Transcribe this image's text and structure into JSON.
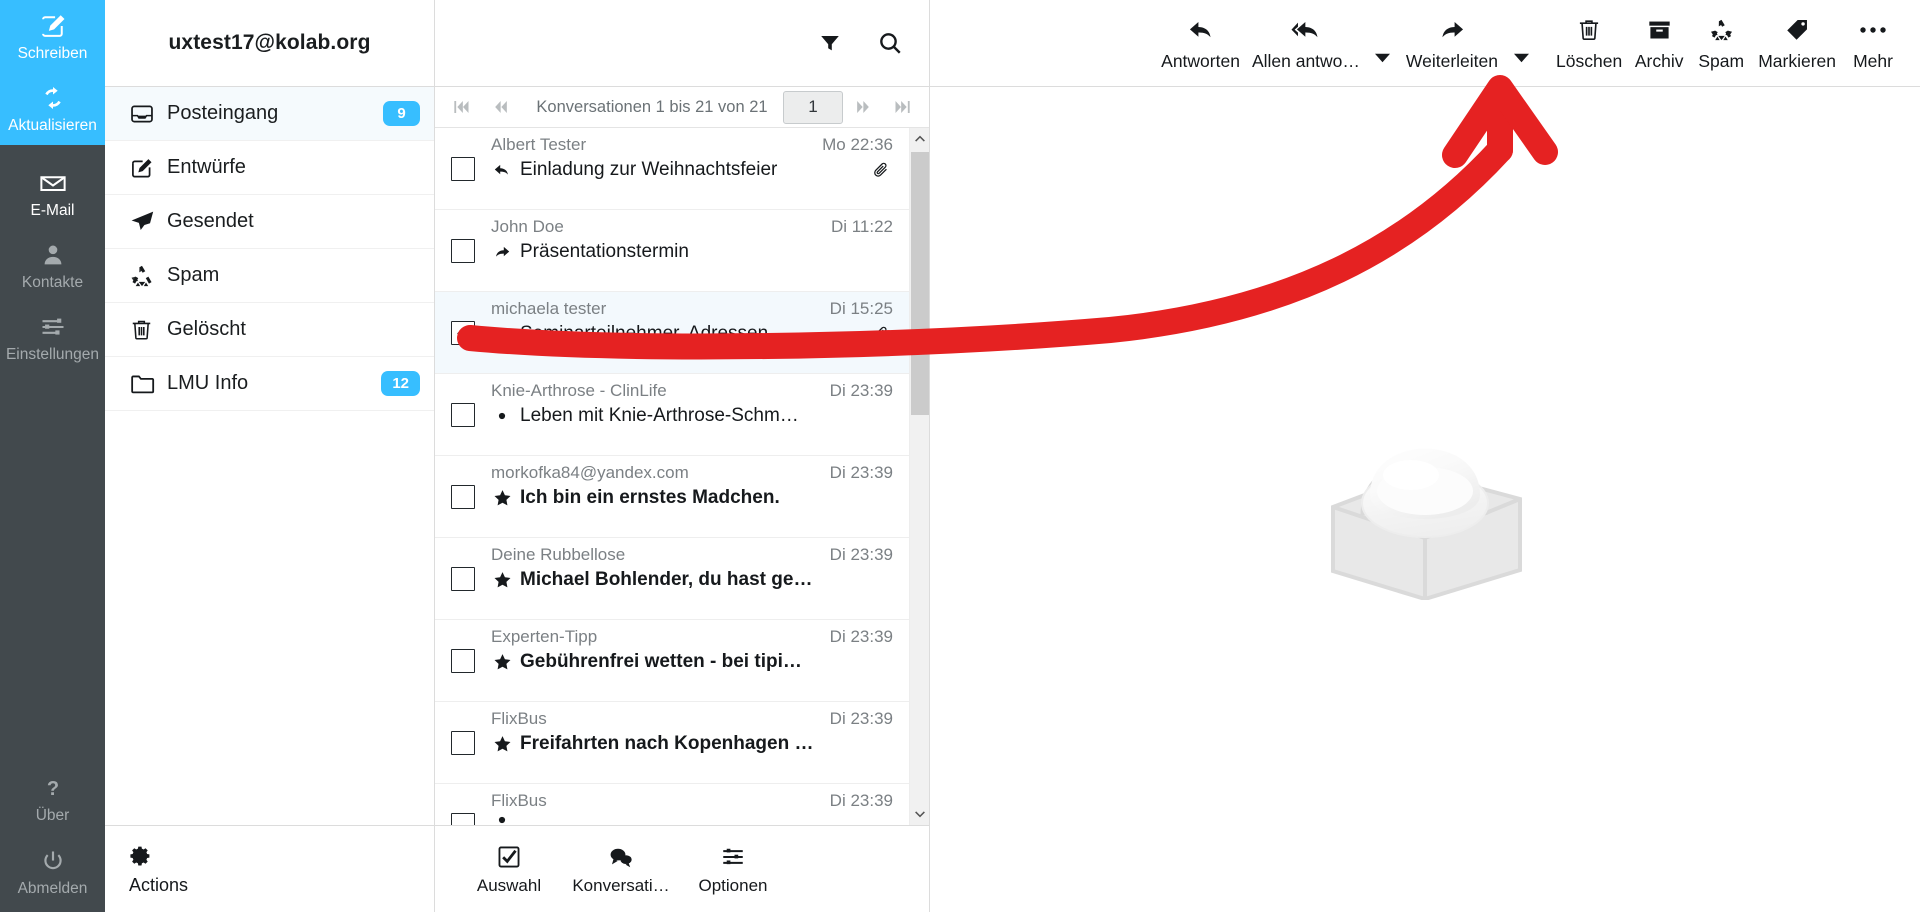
{
  "colors": {
    "accent": "#37beff",
    "rail_bg": "#42494d",
    "rail_text": "#a4aaad",
    "badge": "#37beff",
    "selected_row": "#f3f9fd",
    "annotation": "#e52222"
  },
  "taskmenu": {
    "items": [
      {
        "label": "Schreiben",
        "icon": "compose-icon",
        "state": "accent"
      },
      {
        "label": "Aktualisieren",
        "icon": "refresh-icon",
        "state": "accent"
      },
      {
        "label": "E-Mail",
        "icon": "envelope-icon",
        "state": "active"
      },
      {
        "label": "Kontakte",
        "icon": "person-icon",
        "state": "normal"
      },
      {
        "label": "Einstellungen",
        "icon": "sliders-icon",
        "state": "normal"
      }
    ],
    "bottom_items": [
      {
        "label": "Über",
        "icon": "question-icon"
      },
      {
        "label": "Abmelden",
        "icon": "power-icon"
      }
    ]
  },
  "folders": {
    "account": "uxtest17@kolab.org",
    "items": [
      {
        "label": "Posteingang",
        "icon": "inbox-icon",
        "badge": "9",
        "selected": true
      },
      {
        "label": "Entwürfe",
        "icon": "draft-icon",
        "badge": "",
        "selected": false
      },
      {
        "label": "Gesendet",
        "icon": "sent-icon",
        "badge": "",
        "selected": false
      },
      {
        "label": "Spam",
        "icon": "junk-icon",
        "badge": "",
        "selected": false
      },
      {
        "label": "Gelöscht",
        "icon": "trash-icon",
        "badge": "",
        "selected": false
      },
      {
        "label": "LMU Info",
        "icon": "folder-icon",
        "badge": "12",
        "selected": false
      }
    ],
    "footer": {
      "label": "Actions",
      "icon": "gear-icon"
    }
  },
  "messagelist": {
    "header_icons": [
      {
        "name": "filter-icon"
      },
      {
        "name": "search-icon"
      }
    ],
    "pagination": {
      "first": "first-page-icon",
      "prev": "prev-page-icon",
      "summary": "Konversationen 1 bis 21 von 21",
      "page_value": "1",
      "next": "next-page-icon",
      "last": "last-page-icon"
    },
    "rows": [
      {
        "from": "Albert Tester",
        "date": "Mo 22:36",
        "subject": "Einladung zur Weihnachtsfeier",
        "flag": "replied",
        "attachment": true,
        "unread": false,
        "checked": false,
        "selected": false
      },
      {
        "from": "John Doe",
        "date": "Di 11:22",
        "subject": "Präsentationstermin",
        "flag": "forwarded",
        "attachment": false,
        "unread": false,
        "checked": false,
        "selected": false
      },
      {
        "from": "michaela tester",
        "date": "Di 15:25",
        "subject": "Seminarteilnehmer, Adressen …",
        "flag": "unread-dot",
        "attachment": true,
        "unread": false,
        "checked": true,
        "selected": true
      },
      {
        "from": "Knie-Arthrose - ClinLife",
        "date": "Di 23:39",
        "subject": "Leben mit Knie-Arthrose-Schm…",
        "flag": "unread-dot",
        "attachment": false,
        "unread": false,
        "checked": false,
        "selected": false
      },
      {
        "from": "morkofka84@yandex.com",
        "date": "Di 23:39",
        "subject": "Ich bin ein ernstes Madchen.",
        "flag": "flagged",
        "attachment": false,
        "unread": true,
        "checked": false,
        "selected": false
      },
      {
        "from": "Deine Rubbellose",
        "date": "Di 23:39",
        "subject": "Michael Bohlender, du hast ge…",
        "flag": "flagged",
        "attachment": false,
        "unread": true,
        "checked": false,
        "selected": false
      },
      {
        "from": "Experten-Tipp",
        "date": "Di 23:39",
        "subject": "Gebührenfrei wetten - bei tipi…",
        "flag": "flagged",
        "attachment": false,
        "unread": true,
        "checked": false,
        "selected": false
      },
      {
        "from": "FlixBus",
        "date": "Di 23:39",
        "subject": "Freifahrten nach Kopenhagen …",
        "flag": "flagged",
        "attachment": false,
        "unread": true,
        "checked": false,
        "selected": false
      },
      {
        "from": "FlixBus",
        "date": "Di 23:39",
        "subject": "",
        "flag": "unread-dot",
        "attachment": false,
        "unread": true,
        "checked": false,
        "selected": false
      }
    ],
    "footer": [
      {
        "label": "Auswahl",
        "icon": "checkbox-icon"
      },
      {
        "label": "Konversati…",
        "icon": "conversation-icon"
      },
      {
        "label": "Optionen",
        "icon": "options-icon"
      }
    ]
  },
  "toolbar": {
    "buttons": [
      {
        "label": "Antworten",
        "icon": "reply-icon",
        "caret": false
      },
      {
        "label": "Allen antwo…",
        "icon": "reply-all-icon",
        "caret": true
      },
      {
        "label": "Weiterleiten",
        "icon": "forward-icon",
        "caret": true
      },
      {
        "label": "Löschen",
        "icon": "trash-icon",
        "caret": false
      },
      {
        "label": "Archiv",
        "icon": "archive-icon",
        "caret": false
      },
      {
        "label": "Spam",
        "icon": "junk-icon",
        "caret": false
      },
      {
        "label": "Markieren",
        "icon": "tag-icon",
        "caret": false
      },
      {
        "label": "Mehr",
        "icon": "ellipsis-icon",
        "caret": false
      }
    ]
  },
  "content": {
    "watermark": "roundcube-elastic-logo"
  },
  "annotation": {
    "type": "arrow",
    "color": "#e52222",
    "from_target": "message-checkbox-row-3",
    "to_target": "toolbar-button-mehr"
  }
}
